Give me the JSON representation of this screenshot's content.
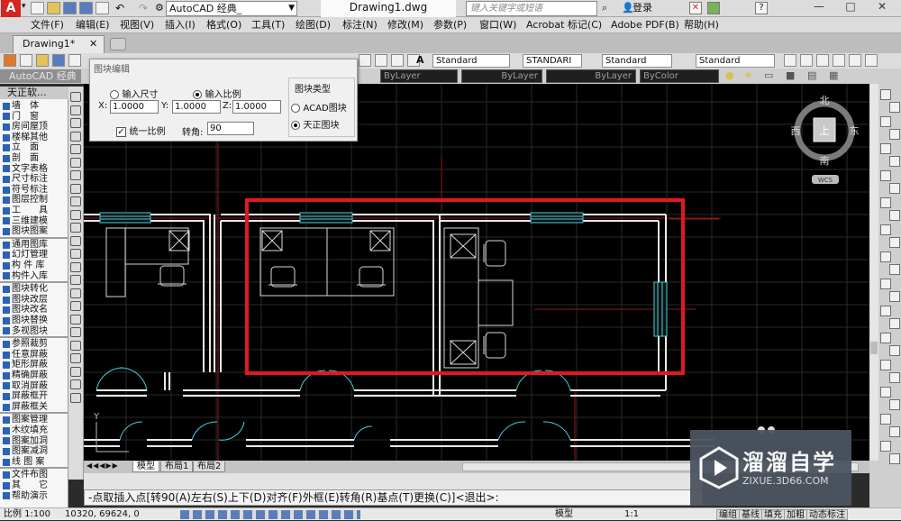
{
  "titlebar": {
    "workspace": "AutoCAD 经典_",
    "document": "Drawing1.dwg",
    "search_placeholder": "键入关键字或短语",
    "login": "登录"
  },
  "menubar": [
    "文件(F)",
    "编辑(E)",
    "视图(V)",
    "插入(I)",
    "格式(O)",
    "工具(T)",
    "绘图(D)",
    "标注(N)",
    "修改(M)",
    "参数(P)",
    "窗口(W)",
    "Acrobat 标记(C)",
    "Adobe PDF(B)",
    "帮助(H)"
  ],
  "tabs": {
    "doc": "Drawing1*"
  },
  "toolbar": {
    "style1": "Standard",
    "style2": "STANDARI",
    "style3": "Standard",
    "style4": "Standard"
  },
  "layers": {
    "workspace_name": "AutoCAD 经典",
    "color": "ByLayer",
    "linetype": "ByLayer",
    "lineweight": "ByLayer",
    "plotstyle": "ByColor"
  },
  "panel": {
    "title": "天正软...",
    "items": [
      "墙　体",
      "门　窗",
      "房间屋顶",
      "楼梯其他",
      "立　面",
      "剖　面",
      "文字表格",
      "尺寸标注",
      "符号标注",
      "图层控制",
      "工　　具",
      "三维建模",
      "图块图案",
      "通用图库",
      "幻灯管理",
      "构 件 库",
      "构件入库",
      "图块转化",
      "图块改层",
      "图块改名",
      "图块替换",
      "多视图块",
      "参照裁剪",
      "任意屏蔽",
      "矩形屏蔽",
      "精确屏蔽",
      "取消屏蔽",
      "屏蔽框开",
      "屏蔽框关",
      "图案管理",
      "木纹填充",
      "图案加洞",
      "图案减洞",
      "线 图 案",
      "文件布图",
      "其　　它",
      "帮助演示"
    ]
  },
  "dialog": {
    "title": "图块编辑",
    "radio_size": "输入尺寸",
    "radio_scale": "输入比例",
    "x_label": "X:",
    "y_label": "Y:",
    "z_label": "Z:",
    "x_value": "1.0000",
    "y_value": "1.0000",
    "z_value": "1.0000",
    "uniform_label": "统一比例",
    "angle_label": "转角:",
    "angle_value": "90",
    "group_title": "图块类型",
    "acad_block": "ACAD图块",
    "tz_block": "天正图块"
  },
  "viewcube": {
    "north": "北",
    "south": "南",
    "east": "东",
    "west": "西",
    "top": "上",
    "wcs": "WCS"
  },
  "layout_tabs": [
    "模型",
    "布局1",
    "布局2"
  ],
  "command": "-点取插入点[转90(A)左右(S)上下(D)对齐(F)外框(E)转角(R)基点(T)更换(C)]<退出>:",
  "status": {
    "scale": "比例 1:100",
    "coords": "10320, 69624, 0",
    "model": "模型",
    "ratio": "1:1",
    "btns": [
      "编组",
      "基线",
      "填充",
      "加粗",
      "动态标注"
    ]
  },
  "logo": {
    "name": "溜溜自学",
    "url": "ZIXUE.3D66.COM"
  },
  "colors": {
    "highlight": "#e0191f",
    "wall": "#ffffff",
    "window": "#3fd4e0"
  }
}
